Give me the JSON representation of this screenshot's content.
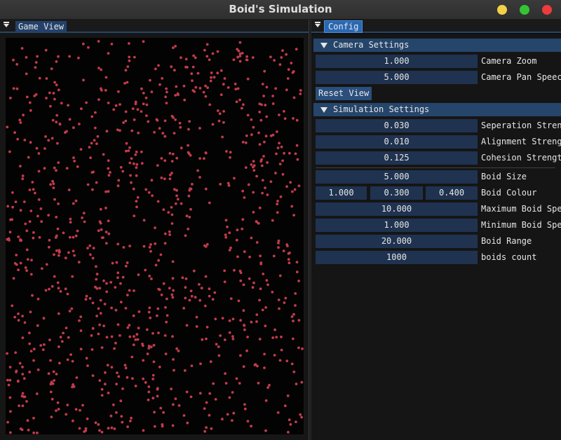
{
  "window": {
    "title": "Boid's Simulation"
  },
  "game_view": {
    "tab_label": "Game View",
    "boid_color": "#c23b4a",
    "background_color": "#030303"
  },
  "config": {
    "tab_label": "Config",
    "camera_section": {
      "header": "Camera Settings",
      "camera_zoom": {
        "value": "1.000",
        "label": "Camera Zoom"
      },
      "camera_pan_speed": {
        "value": "5.000",
        "label": "Camera Pan Speec"
      },
      "reset_button": "Reset View"
    },
    "simulation_section": {
      "header": "Simulation Settings",
      "separation_strength": {
        "value": "0.030",
        "label": "Seperation Stren"
      },
      "alignment_strength": {
        "value": "0.010",
        "label": "Alignment Streng"
      },
      "cohesion_strength": {
        "value": "0.125",
        "label": "Cohesion Strengt"
      },
      "boid_size": {
        "value": "5.000",
        "label": "Boid Size"
      },
      "boid_colour": {
        "r": "1.000",
        "g": "0.300",
        "b": "0.400",
        "label": "Boid Colour"
      },
      "max_speed": {
        "value": "10.000",
        "label": "Maximum Boid Spe"
      },
      "min_speed": {
        "value": "1.000",
        "label": "Minimum Boid Spe"
      },
      "boid_range": {
        "value": "20.000",
        "label": "Boid Range"
      },
      "boids_count": {
        "value": "1000",
        "label": "boids count"
      }
    }
  }
}
